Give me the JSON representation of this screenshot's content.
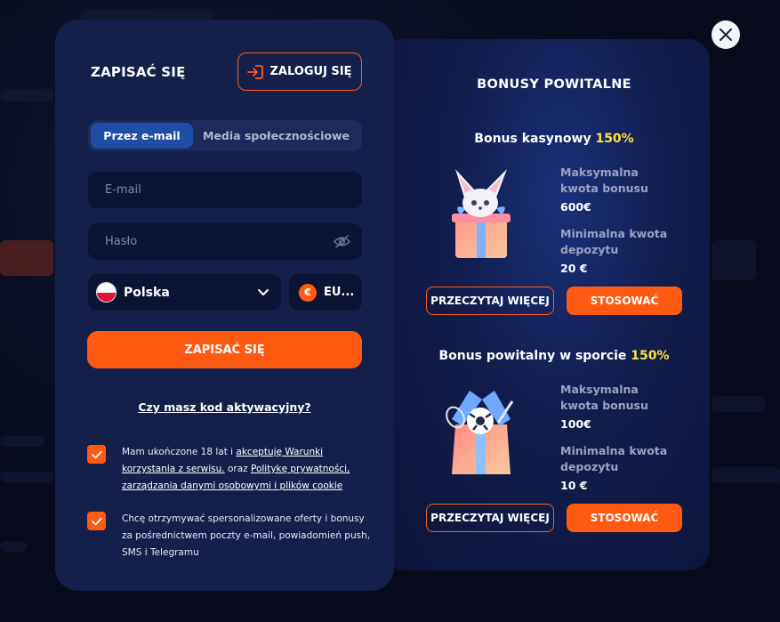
{
  "register": {
    "title": "ZAPISAĆ SIĘ",
    "login_label": "ZALOGUJ SIĘ",
    "tabs": [
      {
        "label": "Przez e-mail"
      },
      {
        "label": "Media społecznościowe"
      }
    ],
    "email_placeholder": "E-mail",
    "password_placeholder": "Hasło",
    "country": "Polska",
    "currency_symbol": "€",
    "currency": "EU...",
    "submit_label": "ZAPISAĆ SIĘ",
    "promo_link": "Czy masz kod aktywacyjny?",
    "consent1": {
      "prefix": "Mam ukończone 18 lat i ",
      "link1": "akceptuję Warunki korzystania z serwisu.",
      "middle": " oraz ",
      "link2": "Politykę prywatności, zarządzania danymi osobowymi i plików cookie"
    },
    "consent2": "Chcę otrzymywać spersonalizowane oferty i bonusy za pośrednictwem poczty e-mail, powiadomień push, SMS i Telegramu"
  },
  "bonuses": {
    "heading": "BONUSY POWITALNE",
    "items": [
      {
        "title": "Bonus kasynowy ",
        "percent": "150%",
        "max_label": "Maksymalna kwota bonusu",
        "max_value": "600€",
        "min_label": "Minimalna kwota depozytu",
        "min_value": "20 €",
        "more_label": "PRZECZYTAJ WIĘCEJ",
        "apply_label": "STOSOWAĆ"
      },
      {
        "title": "Bonus powitalny w sporcie ",
        "percent": "150%",
        "max_label": "Maksymalna kwota bonusu",
        "max_value": "100€",
        "min_label": "Minimalna kwota depozytu",
        "min_value": "10 €",
        "more_label": "PRZECZYTAJ WIĘCEJ",
        "apply_label": "STOSOWAĆ"
      }
    ]
  },
  "icons": {
    "close": "close-icon",
    "login": "login-icon",
    "eye": "eye-off-icon",
    "flag": "poland-flag-icon",
    "chevron": "chevron-down-icon",
    "check": "check-icon"
  },
  "colors": {
    "accent": "#ff5a12",
    "panel": "#15204a",
    "highlight": "#ffe047"
  }
}
